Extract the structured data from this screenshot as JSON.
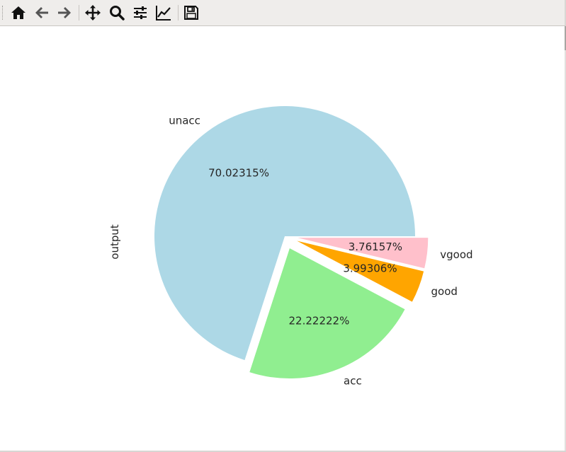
{
  "toolbar": {
    "items": [
      {
        "name": "home-icon"
      },
      {
        "name": "back-arrow-icon"
      },
      {
        "name": "forward-arrow-icon"
      },
      {
        "name": "pan-move-icon"
      },
      {
        "name": "zoom-magnifier-icon"
      },
      {
        "name": "subplots-sliders-icon"
      },
      {
        "name": "edit-axes-chart-icon"
      },
      {
        "name": "save-floppy-icon"
      }
    ]
  },
  "chart_data": {
    "type": "pie",
    "ylabel": "output",
    "slices": [
      {
        "label": "unacc",
        "value": 70.02315,
        "pct_text": "70.02315%",
        "color": "#add8e6",
        "explode": 0.0
      },
      {
        "label": "acc",
        "value": 22.22222,
        "pct_text": "22.22222%",
        "color": "#90ee90",
        "explode": 0.1
      },
      {
        "label": "good",
        "value": 3.99306,
        "pct_text": "3.99306%",
        "color": "#ffa500",
        "explode": 0.1
      },
      {
        "label": "vgood",
        "value": 3.76157,
        "pct_text": "3.76157%",
        "color": "#ffc0cb",
        "explode": 0.1
      }
    ],
    "start_angle_deg": 0,
    "direction": "counterclockwise"
  }
}
